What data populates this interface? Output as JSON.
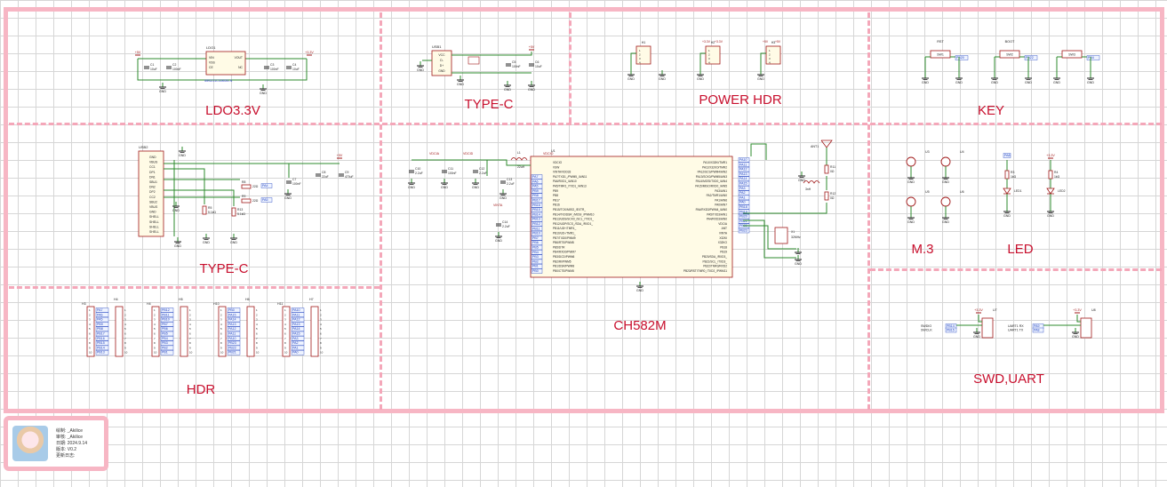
{
  "sections": {
    "ldo": "LDO3.3V",
    "typec_top": "TYPE-C",
    "power_hdr": "POWER HDR",
    "key": "KEY",
    "typec_left": "TYPE-C",
    "mcu": "CH582M",
    "m3": "M.3",
    "led": "LED",
    "hdr": "HDR",
    "swd": "SWD,UART"
  },
  "ldo_block": {
    "ref": "LDO1",
    "part": "ME6211C33M5G-N",
    "pins_left": [
      "VIN",
      "VSS",
      "CE"
    ],
    "pins_right": [
      "VOUT",
      "NC"
    ],
    "in_net": "+5V",
    "out_net": "+3.3V",
    "caps": [
      {
        "ref": "C1",
        "val": "10uF"
      },
      {
        "ref": "C2",
        "val": "100nF"
      },
      {
        "ref": "C3",
        "val": "100nF"
      },
      {
        "ref": "C4",
        "val": "10uF"
      }
    ],
    "gnd": "GND"
  },
  "usb_top": {
    "ref": "USB1",
    "pins": [
      "VCC",
      "D-",
      "D+",
      "GND"
    ],
    "net": "+5V",
    "caps": [
      {
        "ref": "C5",
        "val": "100nF"
      },
      {
        "ref": "C6",
        "val": "10uF"
      }
    ],
    "gnd": "GND"
  },
  "power_hdr_block": {
    "headers": [
      {
        "ref": "H1",
        "nets": [],
        "pins": [
          "1",
          "2",
          "3",
          "4"
        ]
      },
      {
        "ref": "H2",
        "nets": [
          "+3.3V",
          "+3.3V"
        ],
        "pins": [
          "1",
          "2",
          "3",
          "4"
        ]
      },
      {
        "ref": "H3",
        "nets": [
          "+5V",
          "+5V"
        ],
        "pins": [
          "1",
          "2",
          "3",
          "4"
        ]
      }
    ],
    "gnd": "GND"
  },
  "keys": [
    {
      "label": "RST",
      "ref": "SW1",
      "net": "PB20"
    },
    {
      "label": "BOOT",
      "ref": "SW2",
      "net": "PB22"
    },
    {
      "label": "",
      "ref": "SW3",
      "net": "PB4"
    }
  ],
  "usb_left": {
    "ref": "USB2",
    "pins": [
      "GND",
      "VBUS",
      "CC1",
      "DP1",
      "DN1",
      "SBU1",
      "DN2",
      "DP2",
      "CC2",
      "SBU2",
      "VBUS",
      "GND",
      "SHELL",
      "SHELL",
      "SHELL",
      "SHELL"
    ],
    "resistors": [
      {
        "ref": "R5",
        "val": "5.1kΩ"
      },
      {
        "ref": "R13",
        "val": "5.1kΩ"
      },
      {
        "ref": "R8",
        "val": "22Ω"
      },
      {
        "ref": "R9",
        "val": "22Ω"
      }
    ],
    "nets": [
      "PA4",
      "PA5",
      "+5V"
    ],
    "caps": [
      {
        "ref": "C7",
        "val": "100nF"
      },
      {
        "ref": "C8",
        "val": "22uF"
      },
      {
        "ref": "C9",
        "val": "470uF"
      }
    ],
    "gnd": "GND"
  },
  "mcu_block": {
    "ref": "U1",
    "left_pins": [
      "VDCIO",
      "VSW",
      "VINTA/VDD33",
      "PA7/TXD1_/PWM5_/AIN11",
      "PA6/RXD1_/AIN10",
      "PA5/TMR1_/TXD1_/AIN13",
      "PB9",
      "PB8",
      "PB17",
      "PB16",
      "PB15/TCK/MISO_/EXTR_",
      "PB14/TIO/DSR_/MOSI_/PWM10",
      "PB13/UDS/SCK0_/SCL_/TXD1_",
      "PB12/UDP/SCS_/SDA_/RXD1_",
      "PB11/UD+/TMR1_",
      "PB10/UD-/TMR1_",
      "PB7/TXD0/PWM9",
      "PB6/RTS/PWM8",
      "PB5/DTR",
      "PB4/RXD0/PWM7",
      "PB3/DCD/PWM6",
      "PB2/RI/PWM5",
      "PB1/DSR/PWM8",
      "PB0/CTS/PWM8"
    ],
    "right_pins": [
      "PA10/X32KI/TMR1",
      "PA11/X32KO/TMR2",
      "PA12/SCS/PWM4/AIN2",
      "PA13/SCK0/PWM5/AIN3",
      "PA14/MOSI/TXD0_/AIN4",
      "PA15/MISO/RXD0_/AIN5",
      "PA3/AIN1",
      "PA2/TMR1/AIN0",
      "PA1/AIN6",
      "PA0/AIN7",
      "PA4/RXD3/PWM4_/AIN0",
      "PA5/TXD3/AIN1",
      "PA4/RXD3/AIN0",
      "VDCIA",
      "ANT",
      "VINTA",
      "X32KI",
      "X32KO",
      "PB18",
      "PB19",
      "PB20/SDA_/RXD3_",
      "PB21/SCL_/TXD3_",
      "PB22/TMR3/RXD2",
      "PB23/RST/TMR0_/TXD2_/PWM11"
    ],
    "left_nets": [
      "PA7",
      "PA6",
      "PA5",
      "PB9",
      "PB8",
      "PB17",
      "PB16",
      "PB15",
      "PB14",
      "PB13",
      "PB12",
      "PB11",
      "PB10",
      "PB7",
      "PB6",
      "PB5",
      "PB4",
      "PB3",
      "PB2",
      "PB1",
      "PB0"
    ],
    "right_nets": [
      "PA10",
      "PA11",
      "PA12",
      "PA13",
      "PA14",
      "PA15",
      "PA3",
      "PA2",
      "PA1",
      "PA0",
      "PB18",
      "PB19",
      "PB20",
      "PB21",
      "PB22",
      "PB23"
    ],
    "power_nets": [
      "VDCIA",
      "VDCID",
      "VDCIO",
      "VINTA"
    ],
    "caps": [
      {
        "ref": "C10",
        "val": "2.2uF"
      },
      {
        "ref": "C11",
        "val": "100nF"
      },
      {
        "ref": "C12",
        "val": "2.2uF"
      },
      {
        "ref": "C13",
        "val": "2.2uF"
      },
      {
        "ref": "C14",
        "val": "2.2uF"
      }
    ],
    "inductor": {
      "ref": "L1",
      "val": "22uH"
    },
    "crystal": {
      "ref": "X1",
      "val": "32MHz"
    },
    "antenna": "ANT1",
    "rf_parts": [
      {
        "ref": "R11",
        "val": "0Ω"
      },
      {
        "ref": "R12",
        "val": "0Ω"
      },
      {
        "ref": "L2",
        "val": "3nH"
      }
    ],
    "gnd": "GND"
  },
  "m3_block": {
    "refs": [
      "U3",
      "U4",
      "U5",
      "U6"
    ],
    "gnd": "GND"
  },
  "led_block": {
    "leds": [
      {
        "r_ref": "R3",
        "r_val": "1kΩ",
        "d_ref": "LED1",
        "net": "PA8"
      },
      {
        "r_ref": "R4",
        "r_val": "1kΩ",
        "d_ref": "LED2",
        "net": "+3.3V"
      }
    ],
    "gnd": "GND"
  },
  "hdr_block": {
    "headers": [
      {
        "ref": "H3",
        "ref2": "H4",
        "nets": [
          "PA7",
          "PA6",
          "PA5",
          "PB9",
          "PB8",
          "PB17",
          "PB16",
          "PB15",
          "PB14",
          "PB13"
        ]
      },
      {
        "ref": "H4",
        "ref2": "H5",
        "nets": [
          "PB12",
          "PB11",
          "PB10",
          "PB7",
          "PB6",
          "PB5",
          "PB4",
          "PB3",
          "PB2",
          "PB1"
        ]
      },
      {
        "ref": "H10",
        "ref2": "H6",
        "nets": [
          "PB0",
          "PA15",
          "PA14",
          "PA13",
          "PA12",
          "PA11",
          "PA10",
          "PB23",
          "PB22",
          "PB21"
        ]
      },
      {
        "ref": "H11",
        "ref2": "H7",
        "nets": [
          "PA10",
          "PA11",
          "PA12",
          "PA13",
          "PA14",
          "PA15",
          "PA3",
          "PA2",
          "PA1",
          "PA0"
        ]
      }
    ],
    "pin_numbers": [
      "1",
      "2",
      "3",
      "4",
      "5",
      "6",
      "7",
      "8",
      "9",
      "10"
    ]
  },
  "swd_block": {
    "left": {
      "ref": "U7",
      "net": "+3.3V",
      "labels": [
        "SWDIO",
        "SWCLK"
      ],
      "nets": [
        "PB14",
        "PB15"
      ]
    },
    "right": {
      "ref": "U8",
      "net": "+3.3V",
      "labels": [
        "UART1 RX",
        "UART1 TX"
      ],
      "nets": [
        "PA9",
        "PA8"
      ]
    },
    "gnd": "GND"
  },
  "title_block": {
    "lines": [
      "绘制:  _Akilice",
      "审核:  _Akilice",
      "日期:  2024.9.14",
      "版本:  V0.2",
      "更新日志:"
    ]
  },
  "colors": {
    "frame": "#f7b6c4",
    "wire": "#2e8b2e",
    "symbol": "#a11a1a",
    "net_label": "#1d3fbf",
    "section_text": "#c8102e"
  }
}
